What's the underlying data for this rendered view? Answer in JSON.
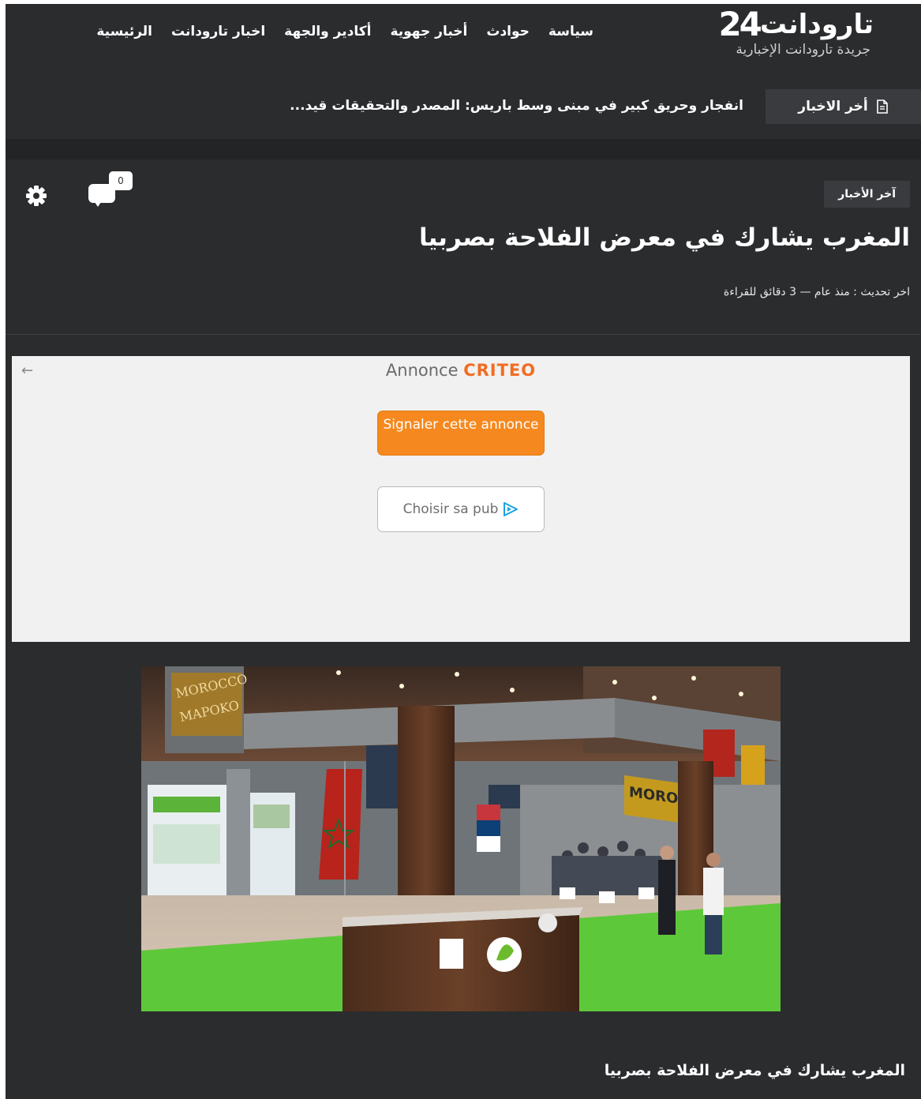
{
  "site": {
    "logo_name": "تارودانت",
    "logo_number": "24",
    "logo_tagline": "جريدة تارودانت الإخبارية"
  },
  "nav": {
    "items": [
      {
        "label": "الرئيسية"
      },
      {
        "label": "اخبار تارودانت"
      },
      {
        "label": "أكادير والجهة"
      },
      {
        "label": "أخبار جهوية"
      },
      {
        "label": "حوادث"
      },
      {
        "label": "سياسة"
      }
    ]
  },
  "ticker": {
    "label": "أخر الاخبار",
    "headline": "انفجار وحريق كبير في مبنى وسط باريس: المصدر والتحقيقات قيد..."
  },
  "article": {
    "category": "آخر الأخبار",
    "comment_count": "0",
    "title": "المغرب يشارك في معرض الفلاحة بصربيا",
    "meta": "اخر تحديث : منذ عام  —  3 دقائق للقراءة",
    "caption": "المغرب يشارك في معرض الفلاحة بصربيا"
  },
  "ad": {
    "label": "Annonce",
    "brand": "CRITEO",
    "report_button": "Signaler cette annonce",
    "choose_button": "Choisir sa pub"
  },
  "photo": {
    "sign_left": "MOROCCO MAPOKO",
    "sign_right": "MOROCCO"
  },
  "colors": {
    "background": "#2b2c2e",
    "accent_orange": "#f5891f",
    "criteo_orange": "#f26c22"
  },
  "icons": [
    "document-icon",
    "comment-icon",
    "gear-icon",
    "back-arrow-icon",
    "play-icon"
  ]
}
